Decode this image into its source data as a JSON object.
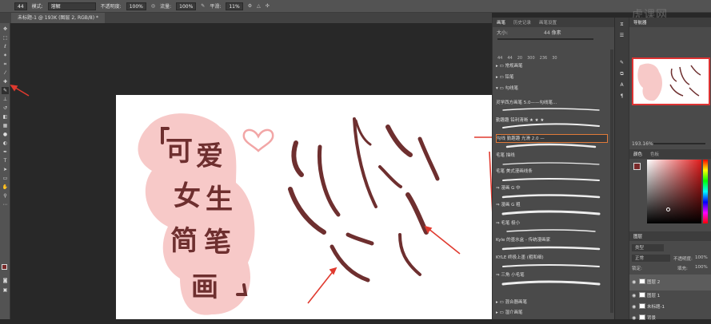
{
  "options": {
    "mode_label": "模式:",
    "mode_value": "溶解",
    "opacity_label": "不透明度:",
    "opacity_value": "100%",
    "flow_label": "流量:",
    "flow_value": "100%",
    "smooth_label": "平滑:",
    "smooth_value": "11%",
    "brush_size_small": "44"
  },
  "document": {
    "tab_title": "未标题-1 @ 193K (图层 2, RGB/8) *"
  },
  "watermark": "虎课网",
  "brush_panel": {
    "tabs": [
      "画笔",
      "历史记录",
      "画笔设置"
    ],
    "size_label": "大小:",
    "size_value": "44 像素",
    "preset_sizes": [
      "44",
      "44",
      "20",
      "300",
      "236",
      "30"
    ],
    "groups": [
      {
        "label": "常规画笔"
      },
      {
        "label": "铅笔"
      },
      {
        "label": "勾线笔"
      }
    ],
    "items": [
      "灵学西方画笔 5.0——勾线笔...",
      "勤趣趣 铅利清晰 ★ ★ ★",
      "勾线 勤趣趣 光滑 2.0 —",
      "毛笔 描线",
      "毛笔 美式漫画线条",
      "⇒ 漫画 G 中",
      "⇒ 漫画 G 粗",
      "⇒ 毛笔 极小",
      "⇒ 毛笔 极小",
      "⇒ 毛笔 极小",
      "Kyle 的墨水盒 - 传统漫画家",
      "KYLE 终极上墨 (粗和细)",
      "⇒ 三角 小毛笔"
    ],
    "footer_groups": [
      "混合器画笔",
      "湿介画笔"
    ]
  },
  "nav": {
    "tabs": [
      "导航器"
    ],
    "zoom": "193.16%",
    "color_tabs": [
      "颜色",
      "色板"
    ],
    "foreground_color": "#7a2a2a"
  },
  "layers": {
    "title": "图层",
    "kind_label": "类型",
    "blend": "正常",
    "opacity_label": "不透明度:",
    "opacity_value": "100%",
    "lock_label": "锁定:",
    "fill_label": "填充:",
    "fill_value": "100%",
    "items": [
      {
        "name": "图层 2",
        "selected": true
      },
      {
        "name": "图层 1",
        "selected": false
      },
      {
        "name": "未标题-1",
        "selected": false
      },
      {
        "name": "背景",
        "selected": false
      }
    ]
  },
  "artwork": {
    "title_chars": [
      "可",
      "爱",
      "女",
      "生",
      "简",
      "笔",
      "画"
    ],
    "stroke_color": "#6e2f2f",
    "blob_color": "#f7c9c8",
    "annotation_color": "#e03a2f"
  }
}
